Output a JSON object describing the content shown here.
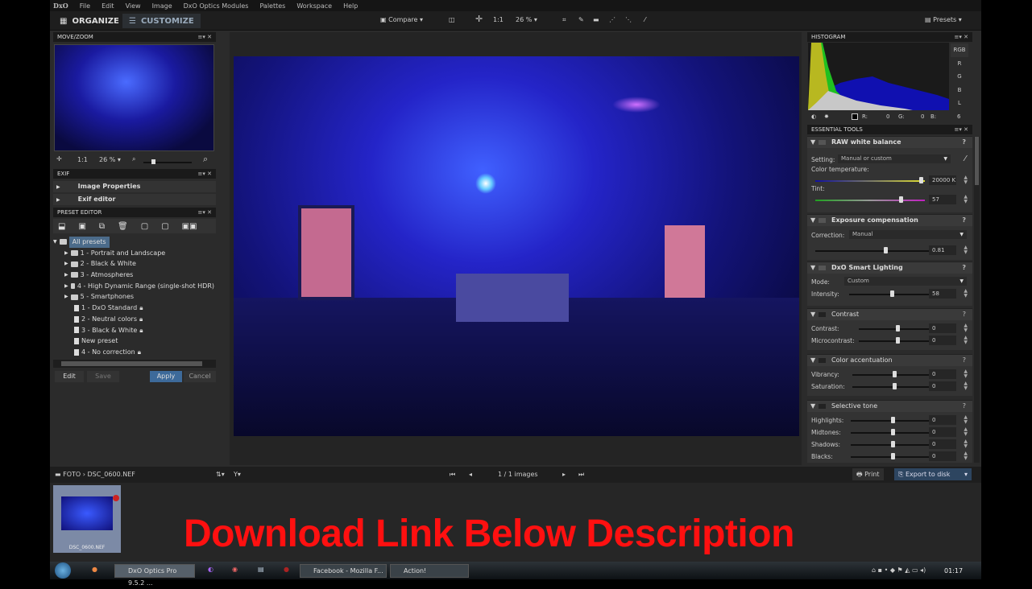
{
  "app": {
    "logo": "DxO",
    "menu": [
      "File",
      "Edit",
      "View",
      "Image",
      "DxO Optics Modules",
      "Palettes",
      "Workspace",
      "Help"
    ]
  },
  "toolbar": {
    "organize": "ORGANIZE",
    "customize": "CUSTOMIZE",
    "compare": "Compare",
    "one_to_one": "1:1",
    "zoom": "26 %",
    "presets": "Presets"
  },
  "move_zoom": {
    "title": "MOVE/ZOOM",
    "one_to_one": "1:1",
    "zoom": "26 %"
  },
  "exif": {
    "title": "EXIF",
    "items": [
      "Image Properties",
      "Exif editor"
    ]
  },
  "preset_editor": {
    "title": "PRESET EDITOR",
    "tree": [
      {
        "label": "All presets",
        "type": "root"
      },
      {
        "label": "1 - Portrait and Landscape",
        "type": "folder"
      },
      {
        "label": "2 - Black & White",
        "type": "folder"
      },
      {
        "label": "3 - Atmospheres",
        "type": "folder"
      },
      {
        "label": "4 - High Dynamic Range (single-shot HDR)",
        "type": "folder"
      },
      {
        "label": "5 - Smartphones",
        "type": "folder"
      },
      {
        "label": "1 - DxO Standard",
        "type": "preset",
        "locked": true
      },
      {
        "label": "2 - Neutral colors",
        "type": "preset",
        "locked": true
      },
      {
        "label": "3 - Black & White",
        "type": "preset",
        "locked": true
      },
      {
        "label": "New preset",
        "type": "preset",
        "locked": false
      },
      {
        "label": "4 - No correction",
        "type": "preset",
        "locked": true
      }
    ],
    "buttons": {
      "edit": "Edit",
      "save": "Save",
      "apply": "Apply",
      "cancel": "Cancel"
    }
  },
  "histogram": {
    "title": "HISTOGRAM",
    "channels": [
      "RGB",
      "R",
      "G",
      "B",
      "L"
    ],
    "readout": {
      "r_label": "R:",
      "r": "0",
      "g_label": "G:",
      "g": "0",
      "b_label": "B:",
      "b": "6"
    }
  },
  "essential_tools": {
    "title": "ESSENTIAL TOOLS",
    "white_balance": {
      "title": "RAW white balance",
      "setting_label": "Setting:",
      "setting": "Manual or custom",
      "temp_label": "Color temperature:",
      "temp": "20000 K",
      "temp_pos": 0.97,
      "tint_label": "Tint:",
      "tint": "57",
      "tint_pos": 0.78
    },
    "exposure": {
      "title": "Exposure compensation",
      "correction_label": "Correction:",
      "correction": "Manual",
      "value": "0.81",
      "pos": 0.6
    },
    "smart_lighting": {
      "title": "DxO Smart Lighting",
      "mode_label": "Mode:",
      "mode": "Custom",
      "intensity_label": "Intensity:",
      "intensity": "58",
      "pos": 0.5
    },
    "contrast": {
      "title": "Contrast",
      "controls": [
        {
          "label": "Contrast:",
          "value": "0",
          "pos": 0.5
        },
        {
          "label": "Microcontrast:",
          "value": "0",
          "pos": 0.5
        }
      ]
    },
    "color": {
      "title": "Color accentuation",
      "controls": [
        {
          "label": "Vibrancy:",
          "value": "0",
          "pos": 0.5
        },
        {
          "label": "Saturation:",
          "value": "0",
          "pos": 0.5
        }
      ]
    },
    "selective_tone": {
      "title": "Selective tone",
      "controls": [
        {
          "label": "Highlights:",
          "value": "0",
          "pos": 0.5
        },
        {
          "label": "Midtones:",
          "value": "0",
          "pos": 0.5
        },
        {
          "label": "Shadows:",
          "value": "0",
          "pos": 0.5
        },
        {
          "label": "Blacks:",
          "value": "0",
          "pos": 0.5
        }
      ]
    }
  },
  "bottombar": {
    "path": "FOTO › DSC_0600.NEF",
    "count": "1 / 1 images",
    "print": "Print",
    "export": "Export to disk"
  },
  "filmstrip": {
    "thumb_label": "DSC_0600.NEF"
  },
  "overlay": {
    "text": "Download Link Below Description",
    "color": "#ff1010"
  },
  "taskbar": {
    "tasks": [
      "DxO Optics Pro 9.5.2 ...",
      "Facebook - Mozilla F...",
      "Action!"
    ],
    "clock": "01:17"
  }
}
